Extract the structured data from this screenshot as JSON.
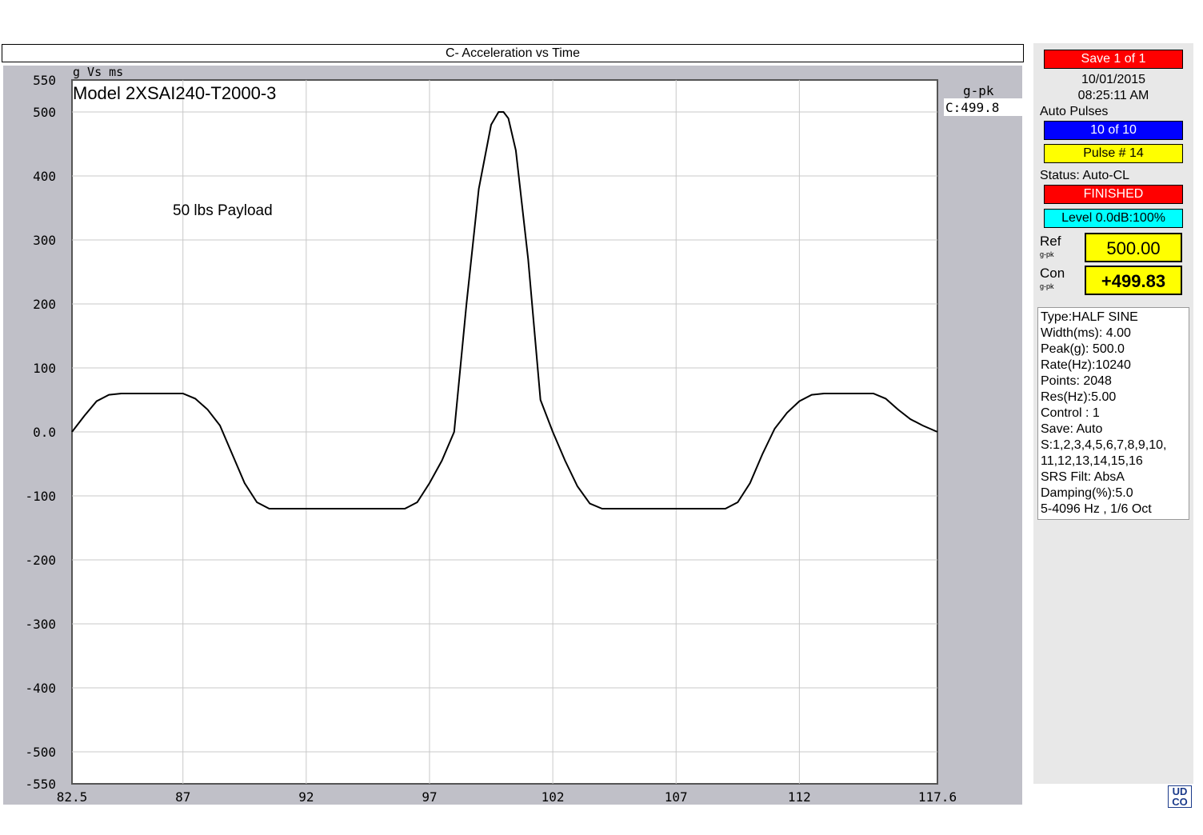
{
  "window_title": "C- Acceleration vs Time",
  "chart_data": {
    "type": "line",
    "title": "Model 2XSAI240-T2000-3",
    "units_label": "g Vs ms",
    "annotation": "50 lbs Payload",
    "xlabel": "",
    "ylabel": "",
    "xlim": [
      82.5,
      117.6
    ],
    "ylim": [
      -550,
      550
    ],
    "x_ticks": [
      "82.5",
      "87",
      "92",
      "97",
      "102",
      "107",
      "112",
      "117.6"
    ],
    "y_ticks": [
      "550",
      "500",
      "400",
      "300",
      "200",
      "100",
      "0.0",
      "-100",
      "-200",
      "-300",
      "-400",
      "-500",
      "-550"
    ],
    "grid": true,
    "series": [
      {
        "name": "",
        "x": [
          82.5,
          83.0,
          83.5,
          84.0,
          84.5,
          85.0,
          86.0,
          87.0,
          87.5,
          88.0,
          88.5,
          89.0,
          89.5,
          90.0,
          90.5,
          91.0,
          92.0,
          93.0,
          94.0,
          95.0,
          96.0,
          96.5,
          97.0,
          97.5,
          98.0,
          98.5,
          99.0,
          99.5,
          99.8,
          100.0,
          100.2,
          100.5,
          101.0,
          101.5,
          102.0,
          102.5,
          103.0,
          103.5,
          104.0,
          105.0,
          106.0,
          107.0,
          108.0,
          109.0,
          109.5,
          110.0,
          110.5,
          111.0,
          111.5,
          112.0,
          112.5,
          113.0,
          114.0,
          115.0,
          115.5,
          116.0,
          116.5,
          117.0,
          117.6
        ],
        "y": [
          0,
          25,
          48,
          58,
          60,
          60,
          60,
          60,
          52,
          35,
          10,
          -35,
          -80,
          -110,
          -120,
          -120,
          -120,
          -120,
          -120,
          -120,
          -120,
          -110,
          -80,
          -45,
          0,
          200,
          380,
          480,
          500,
          500,
          490,
          440,
          270,
          50,
          0,
          -45,
          -85,
          -112,
          -120,
          -120,
          -120,
          -120,
          -120,
          -120,
          -110,
          -80,
          -35,
          5,
          30,
          48,
          58,
          60,
          60,
          60,
          52,
          35,
          20,
          10,
          0
        ]
      }
    ],
    "readout_label": "g-pk",
    "readout_value": "C:499.8",
    "line_color": "#000000",
    "panel_color": "#c0c0c8"
  },
  "sidebar": {
    "save_status": "Save   1 of   1",
    "date": "10/01/2015",
    "time": "08:25:11 AM",
    "auto_pulses_label": "Auto Pulses",
    "auto_pulses_value": "10 of  10",
    "pulse_number": "Pulse #  14",
    "status_label": "Status: Auto-CL",
    "status_value": "FINISHED",
    "level": "Level 0.0dB:100%",
    "ref_label": "Ref",
    "ref_unit": "g-pk",
    "ref_value": "500.00",
    "con_label": "Con",
    "con_unit": "g-pk",
    "con_value": "+499.83",
    "params": [
      "Type:HALF SINE",
      "Width(ms):  4.00",
      "Peak(g): 500.0",
      "Rate(Hz):10240",
      "Points: 2048",
      "Res(Hz):5.00",
      "Control :  1",
      "Save: Auto",
      "S:1,2,3,4,5,6,7,8,9,10,",
      "11,12,13,14,15,16",
      "SRS Filt: AbsA",
      "Damping(%):5.0",
      "5-4096 Hz , 1/6 Oct"
    ],
    "colors": {
      "red": "#ff0000",
      "blue": "#0000ff",
      "yellow": "#ffff00",
      "cyan": "#00ffff"
    }
  },
  "logo_text": "UDCO"
}
